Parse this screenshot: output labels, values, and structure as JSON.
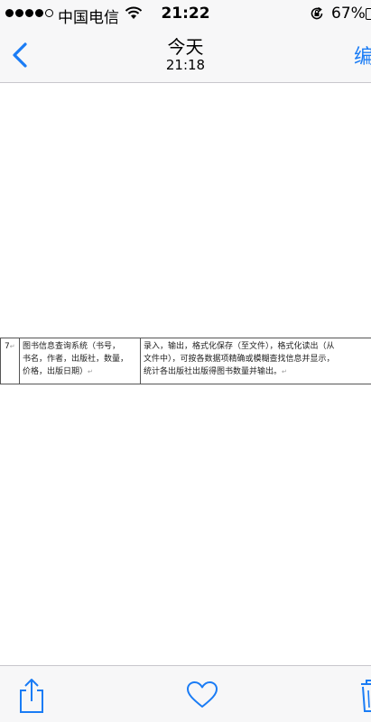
{
  "status_bar": {
    "carrier": "中国电信",
    "time": "21:22",
    "battery_percent": "67%",
    "signal_strength_of_5": 4
  },
  "nav": {
    "title": "今天",
    "subtitle": "21:18",
    "edit_label": "编",
    "back_icon": "chevron-left-icon",
    "accent_color": "#1a7cf5"
  },
  "document": {
    "row": {
      "number": "7",
      "mark": "↵",
      "col2_lines": [
        "图书信息查询系统（书号，",
        "书名，作者，出版社，数量，",
        "价格，出版日期）"
      ],
      "col3_lines": [
        "录入，输出，格式化保存（至文件），格式化读出（从",
        "文件中），可按各数据项精确或模糊查找信息并显示，",
        "统计各出版社出版得图书数量并输出。"
      ]
    }
  },
  "toolbar": {
    "icons": [
      "share-icon",
      "heart-icon",
      "trash-icon"
    ]
  }
}
